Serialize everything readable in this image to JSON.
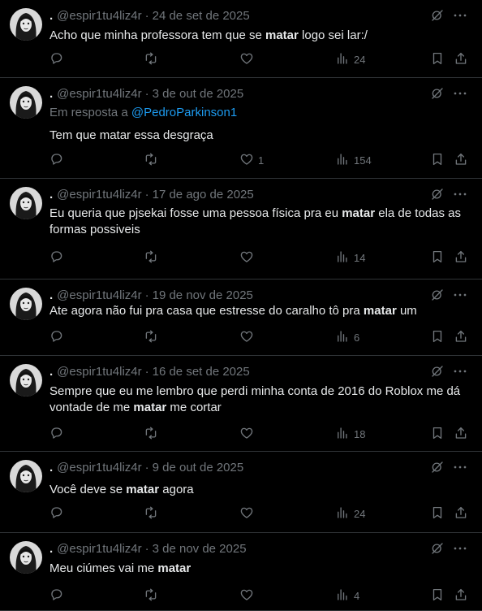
{
  "tweets": [
    {
      "name": ".",
      "handle": "@espir1tu4liz4r",
      "date": "24 de set de 2025",
      "reply_prefix": "",
      "reply_handle": "",
      "text": [
        {
          "t": "Acho que minha professora tem que se "
        },
        {
          "t": "matar",
          "b": true
        },
        {
          "t": " logo sei lar:/"
        }
      ],
      "replies": "",
      "retweets": "",
      "likes": "",
      "views": "24"
    },
    {
      "name": ".",
      "handle": "@espir1tu4liz4r",
      "date": "3 de out de 2025",
      "reply_prefix": "Em resposta a ",
      "reply_handle": "@PedroParkinson1",
      "text": [
        {
          "t": "Tem que matar essa desgraça"
        }
      ],
      "replies": "",
      "retweets": "",
      "likes": "1",
      "views": "154"
    },
    {
      "name": ".",
      "handle": "@espir1tu4liz4r",
      "date": "17 de ago de 2025",
      "reply_prefix": "",
      "reply_handle": "",
      "text": [
        {
          "t": "Eu queria que pjsekai fosse uma pessoa física pra eu "
        },
        {
          "t": "matar",
          "b": true
        },
        {
          "t": " ela de todas as formas possiveis"
        }
      ],
      "replies": "",
      "retweets": "",
      "likes": "",
      "views": "14"
    },
    {
      "name": ".",
      "handle": "@espir1tu4liz4r",
      "date": "19 de nov de 2025",
      "reply_prefix": "",
      "reply_handle": "",
      "text": [
        {
          "t": "Ate agora não fui pra casa que estresse do caralho tô pra "
        },
        {
          "t": "matar",
          "b": true
        },
        {
          "t": " um"
        }
      ],
      "replies": "",
      "retweets": "",
      "likes": "",
      "views": "6"
    },
    {
      "name": ".",
      "handle": "@espir1tu4liz4r",
      "date": "16 de set de 2025",
      "reply_prefix": "",
      "reply_handle": "",
      "text": [
        {
          "t": "Sempre que eu me lembro que perdi minha conta de 2016 do Roblox me dá vontade de me "
        },
        {
          "t": "matar",
          "b": true
        },
        {
          "t": " me cortar"
        }
      ],
      "replies": "",
      "retweets": "",
      "likes": "",
      "views": "18"
    },
    {
      "name": ".",
      "handle": "@espir1tu4liz4r",
      "date": "9 de out de 2025",
      "reply_prefix": "",
      "reply_handle": "",
      "text": [
        {
          "t": "Você deve se "
        },
        {
          "t": "matar",
          "b": true
        },
        {
          "t": " agora"
        }
      ],
      "replies": "",
      "retweets": "",
      "likes": "",
      "views": "24"
    },
    {
      "name": ".",
      "handle": "@espir1tu4liz4r",
      "date": "3 de nov de 2025",
      "reply_prefix": "",
      "reply_handle": "",
      "text": [
        {
          "t": "Meu ciúmes vai me "
        },
        {
          "t": "matar",
          "b": true
        }
      ],
      "replies": "",
      "retweets": "",
      "likes": "",
      "views": "4"
    }
  ]
}
